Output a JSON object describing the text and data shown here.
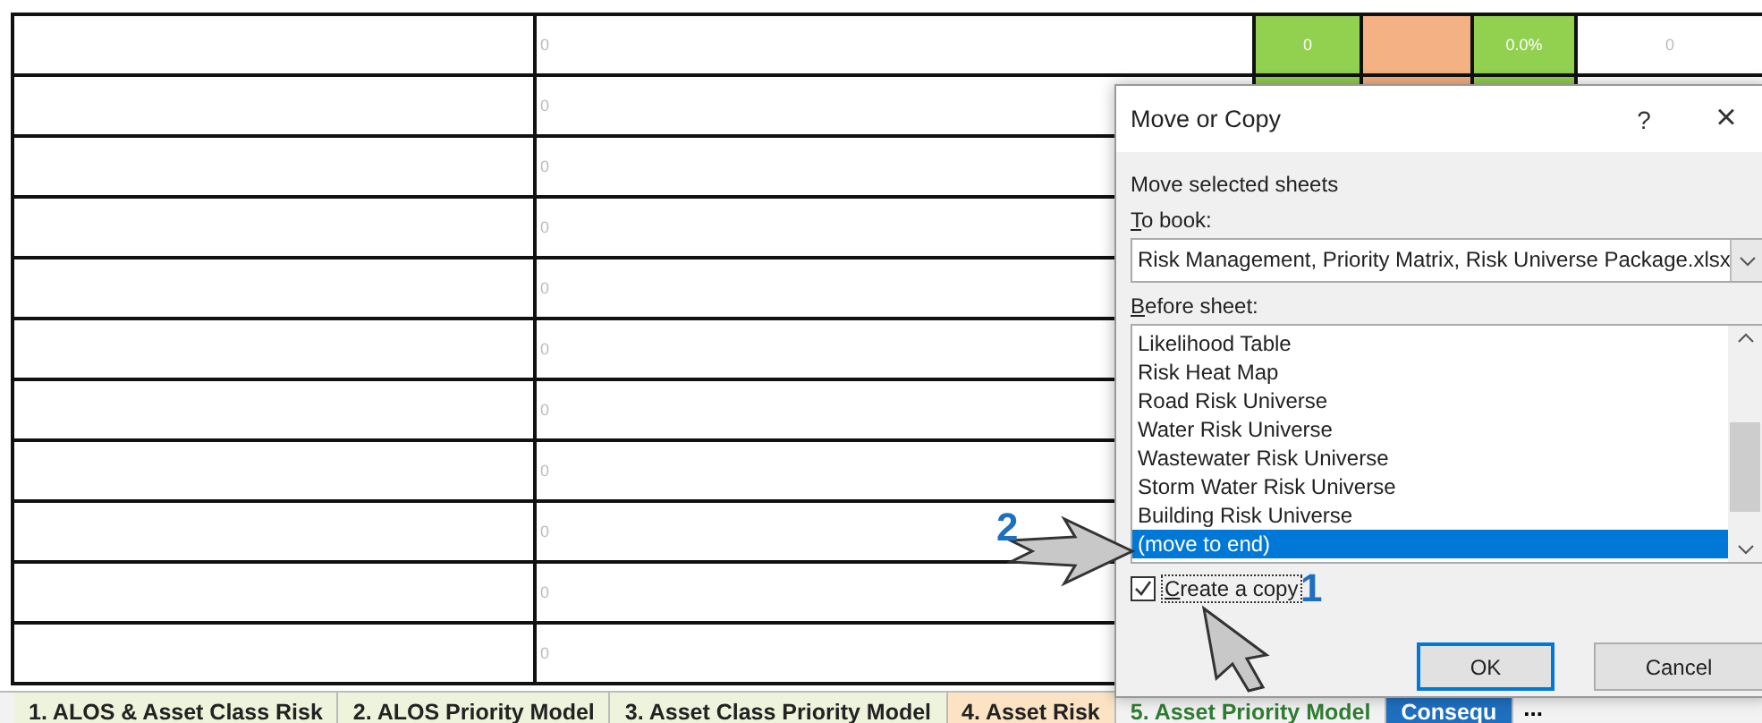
{
  "sheet": {
    "columns": [
      {
        "kind": "plain"
      },
      {
        "kind": "plain"
      },
      {
        "kind": "fill",
        "color": "#92d050"
      },
      {
        "kind": "fill",
        "color": "#f4b183"
      },
      {
        "kind": "fill",
        "color": "#92d050"
      },
      {
        "kind": "plain"
      }
    ],
    "rows": [
      {
        "cells": [
          null,
          "0",
          "0",
          null,
          "0.0%",
          "0"
        ]
      },
      {
        "cells": [
          null,
          "0"
        ]
      },
      {
        "cells": [
          null,
          "0"
        ]
      },
      {
        "cells": [
          null,
          "0"
        ]
      },
      {
        "cells": [
          null,
          "0"
        ]
      },
      {
        "cells": [
          null,
          "0"
        ]
      },
      {
        "cells": [
          null,
          "0"
        ]
      },
      {
        "cells": [
          null,
          "0"
        ]
      },
      {
        "cells": [
          null,
          "0"
        ]
      },
      {
        "cells": [
          null,
          "0"
        ]
      },
      {
        "cells": [
          null,
          "0"
        ]
      }
    ]
  },
  "sheet_tabs": [
    {
      "label": "1. ALOS & Asset Class Risk",
      "selected": false,
      "color": "#eef3dc"
    },
    {
      "label": "2. ALOS Priority Model",
      "selected": false,
      "color": "#eef3dc"
    },
    {
      "label": "3. Asset Class Priority Model",
      "selected": false,
      "color": "#eef3dc"
    },
    {
      "label": "4. Asset Risk",
      "selected": false,
      "color": "#fbe3c4"
    },
    {
      "label": "5. Asset Priority Model",
      "selected": false,
      "color": "#f2f2f2"
    },
    {
      "label": "Consequ",
      "selected": true,
      "color": "#1f6fc0"
    }
  ],
  "tab_overflow": "...",
  "dialog": {
    "title": "Move or Copy",
    "help": "?",
    "close": "×",
    "subtitle": "Move selected sheets",
    "to_book_label": "To book:",
    "to_book_value": "Risk Management, Priority Matrix, Risk Universe Package.xlsx",
    "before_sheet_label": "Before sheet:",
    "sheets": [
      {
        "label": "Likelihood Table",
        "selected": false
      },
      {
        "label": "Risk Heat Map",
        "selected": false
      },
      {
        "label": "Road Risk Universe",
        "selected": false
      },
      {
        "label": "Water Risk Universe",
        "selected": false
      },
      {
        "label": "Wastewater Risk Universe",
        "selected": false
      },
      {
        "label": "Storm Water Risk Universe",
        "selected": false
      },
      {
        "label": "Building Risk Universe",
        "selected": false
      },
      {
        "label": "(move to end)",
        "selected": true
      }
    ],
    "create_copy": {
      "label": "Create a copy",
      "checked": true
    },
    "buttons": [
      {
        "label": "OK",
        "default": true
      },
      {
        "label": "Cancel",
        "default": false
      }
    ]
  },
  "annotations": [
    {
      "number": "2",
      "kind": "right"
    },
    {
      "number": "1",
      "kind": "up"
    }
  ]
}
